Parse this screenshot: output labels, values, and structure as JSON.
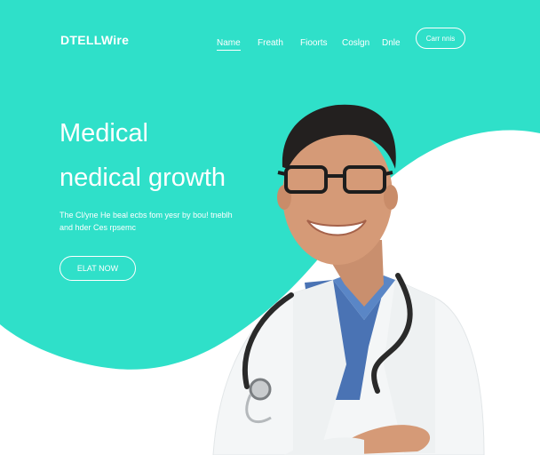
{
  "brand": {
    "logo_text": "DTELLWire",
    "accent_color": "#2fe0c9"
  },
  "nav": {
    "items": [
      {
        "label": "Name",
        "active": true
      },
      {
        "label": "Freath",
        "active": false
      },
      {
        "label": "Fioorts",
        "active": false
      },
      {
        "label": "Coslgn",
        "active": false
      },
      {
        "label": "Dnle",
        "active": false
      }
    ],
    "cta_label": "Carr nnis"
  },
  "hero": {
    "title_line1": "Medical",
    "title_line2": "nedical growth",
    "subtitle_line1": "The Cl/yne He beal ecbs fom yesr by bou! tneblh",
    "subtitle_line2": "and hder Ces rpsemc",
    "cta_label": "ELAT NOW"
  },
  "image": {
    "subject": "smiling doctor with glasses, white coat and stethoscope"
  }
}
